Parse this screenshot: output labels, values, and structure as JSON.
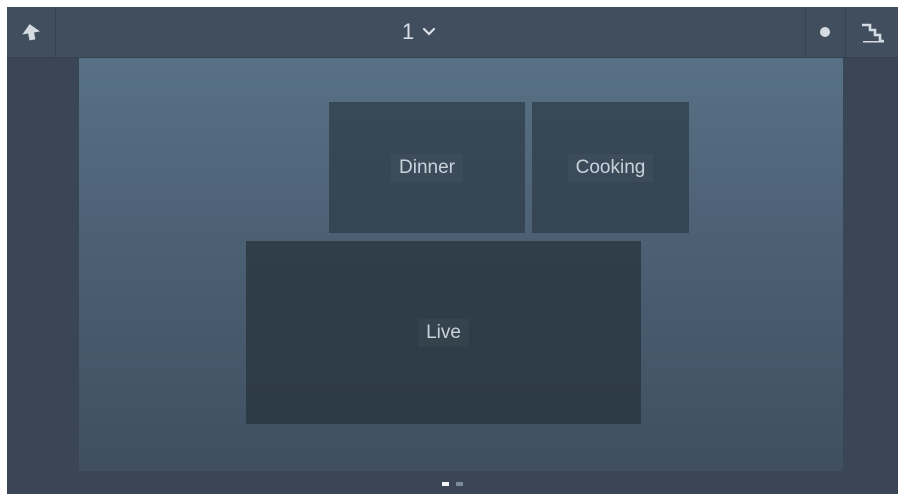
{
  "topbar": {
    "back_icon": "back-arrow-icon",
    "page_number": "1",
    "page_chevron_icon": "chevron-down-icon",
    "dot_icon": "dot-icon",
    "stairs_icon": "stairs-icon"
  },
  "tiles": [
    {
      "label": "Dinner"
    },
    {
      "label": "Cooking"
    },
    {
      "label": "Live"
    }
  ],
  "pager": {
    "current": 1,
    "total": 2
  },
  "colors": {
    "background": "#3a4655",
    "topbar": "#414e5e",
    "tile": "#2c3a46",
    "text": "#c9d2da",
    "active_dot": "#f2f4f6"
  }
}
